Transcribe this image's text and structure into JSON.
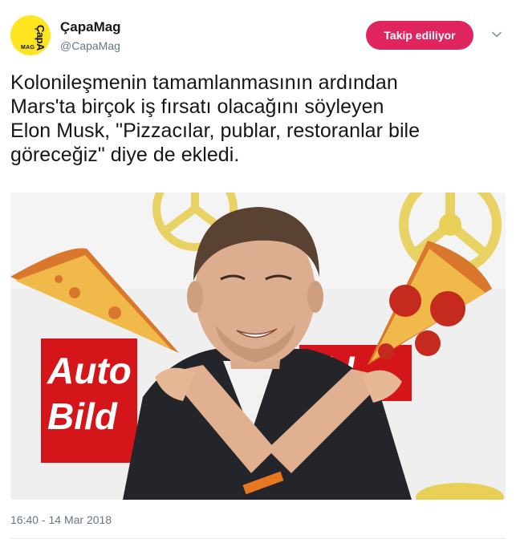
{
  "account": {
    "display_name": "ÇapaMag",
    "handle": "@CapaMag",
    "avatar_text_top": "ÇapA",
    "avatar_text_bottom": "MAG"
  },
  "follow_button": {
    "label": "Takip ediliyor",
    "color": "#e0245e"
  },
  "menu": {
    "icon": "chevron-down-icon"
  },
  "tweet": {
    "lines": [
      "Kolonileşmenin tamamlanmasının ardından",
      "Mars'ta birçok iş fırsatı olacağını söyleyen",
      "Elon Musk, \"Pizzacılar, publar, restoranlar bile",
      "göreceğiz\" diye de ekledi."
    ],
    "timestamp": "16:40 - 14 Mar 2018"
  },
  "photo": {
    "sign_left": "Auto",
    "sign_left_2": "Bild",
    "sign_right": "ild"
  },
  "colors": {
    "avatar_bg": "#ffe51f",
    "secondary_text": "#657786",
    "sign_red": "#d4161b"
  }
}
